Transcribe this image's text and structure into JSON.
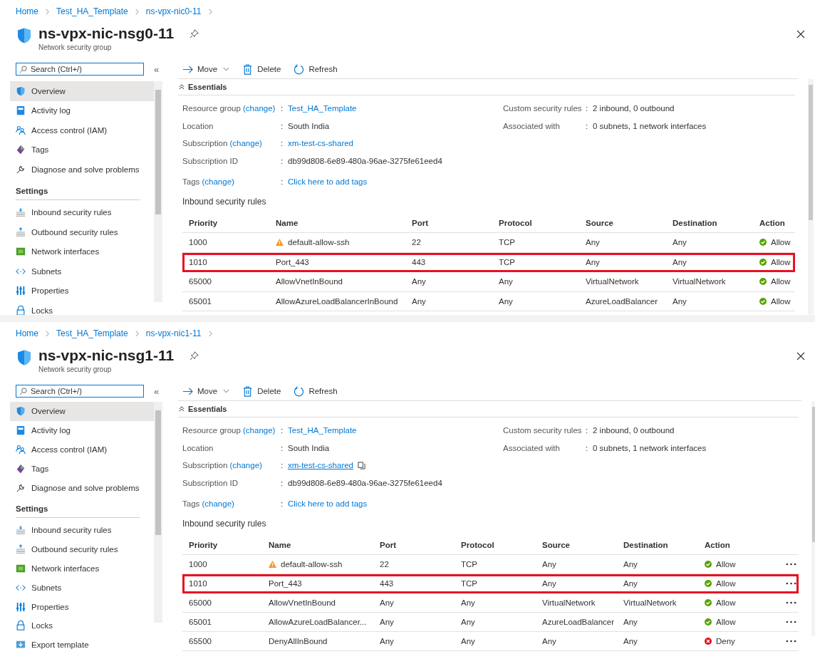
{
  "panels": [
    {
      "breadcrumb": [
        "Home",
        "Test_HA_Template",
        "ns-vpx-nic0-11"
      ],
      "title": "ns-vpx-nic-nsg0-11",
      "subtitle": "Network security group",
      "search": {
        "placeholder": "Search (Ctrl+/)"
      },
      "collapse": "«",
      "sidebar": {
        "items": [
          {
            "label": "Overview",
            "kind": "shield",
            "selected": true
          },
          {
            "label": "Activity log",
            "kind": "log",
            "selected": false
          },
          {
            "label": "Access control (IAM)",
            "kind": "people",
            "selected": false
          },
          {
            "label": "Tags",
            "kind": "tag",
            "selected": false
          },
          {
            "label": "Diagnose and solve problems",
            "kind": "wrench",
            "selected": false
          }
        ],
        "section": {
          "title": "Settings",
          "items": [
            {
              "label": "Inbound security rules",
              "kind": "inbound",
              "selected": false
            },
            {
              "label": "Outbound security rules",
              "kind": "outbound",
              "selected": false
            },
            {
              "label": "Network interfaces",
              "kind": "nic",
              "selected": false
            },
            {
              "label": "Subnets",
              "kind": "subnet",
              "selected": false
            },
            {
              "label": "Properties",
              "kind": "props",
              "selected": false
            },
            {
              "label": "Locks",
              "kind": "lock",
              "selected": false
            }
          ]
        }
      },
      "toolbar": [
        {
          "label": "Move",
          "kind": "move"
        },
        {
          "label": "Delete",
          "kind": "delete"
        },
        {
          "label": "Refresh",
          "kind": "refresh"
        }
      ],
      "essentials": {
        "title": "Essentials",
        "left": [
          {
            "label": "Resource group",
            "change": "(change)",
            "sep": ":",
            "value": "Test_HA_Template",
            "kind": "link",
            "copyable": false
          },
          {
            "label": "Location",
            "sep": ":",
            "value": "South India",
            "kind": "text",
            "copyable": false
          },
          {
            "label": "Subscription",
            "change": "(change)",
            "sep": ":",
            "value": "xm-test-cs-shared",
            "kind": "link",
            "copyable": false
          },
          {
            "label": "Subscription ID",
            "sep": ":",
            "value": "db99d808-6e89-480a-96ae-3275fe61eed4",
            "kind": "text",
            "copyable": false
          },
          {
            "label": "Tags",
            "change": "(change)",
            "sep": ":",
            "value": "Click here to add tags",
            "kind": "link",
            "copyable": false
          }
        ],
        "right": [
          {
            "label": "Custom security rules",
            "sep": ":",
            "value": "2 inbound, 0 outbound",
            "kind": "text",
            "copyable": false
          },
          {
            "label": "Associated with",
            "sep": ":",
            "value": "0 subnets, 1 network interfaces",
            "kind": "text",
            "copyable": false
          }
        ]
      },
      "rules": {
        "title": "Inbound security rules",
        "row_menu": false,
        "columns": [
          "Priority",
          "Name",
          "Port",
          "Protocol",
          "Source",
          "Destination",
          "Action"
        ],
        "rows": [
          {
            "priority": "1000",
            "name": "default-allow-ssh",
            "warning": true,
            "port": "22",
            "protocol": "TCP",
            "source": "Any",
            "destination": "Any",
            "action": "Allow",
            "kind": "allow",
            "highlighted": false
          },
          {
            "priority": "1010",
            "name": "Port_443",
            "warning": false,
            "port": "443",
            "protocol": "TCP",
            "source": "Any",
            "destination": "Any",
            "action": "Allow",
            "kind": "allow",
            "highlighted": true
          },
          {
            "priority": "65000",
            "name": "AllowVnetInBound",
            "warning": false,
            "port": "Any",
            "protocol": "Any",
            "source": "VirtualNetwork",
            "destination": "VirtualNetwork",
            "action": "Allow",
            "kind": "allow",
            "highlighted": false
          },
          {
            "priority": "65001",
            "name": "AllowAzureLoadBalancerInBound",
            "warning": false,
            "port": "Any",
            "protocol": "Any",
            "source": "AzureLoadBalancer",
            "destination": "Any",
            "action": "Allow",
            "kind": "allow",
            "highlighted": false
          }
        ]
      }
    },
    {
      "breadcrumb": [
        "Home",
        "Test_HA_Template",
        "ns-vpx-nic1-11"
      ],
      "title": "ns-vpx-nic-nsg1-11",
      "subtitle": "Network security group",
      "search": {
        "placeholder": "Search (Ctrl+/)"
      },
      "collapse": "«",
      "sidebar": {
        "items": [
          {
            "label": "Overview",
            "kind": "shield",
            "selected": true
          },
          {
            "label": "Activity log",
            "kind": "log",
            "selected": false
          },
          {
            "label": "Access control (IAM)",
            "kind": "people",
            "selected": false
          },
          {
            "label": "Tags",
            "kind": "tag",
            "selected": false
          },
          {
            "label": "Diagnose and solve problems",
            "kind": "wrench",
            "selected": false
          }
        ],
        "section": {
          "title": "Settings",
          "items": [
            {
              "label": "Inbound security rules",
              "kind": "inbound",
              "selected": false
            },
            {
              "label": "Outbound security rules",
              "kind": "outbound",
              "selected": false
            },
            {
              "label": "Network interfaces",
              "kind": "nic",
              "selected": false
            },
            {
              "label": "Subnets",
              "kind": "subnet",
              "selected": false
            },
            {
              "label": "Properties",
              "kind": "props",
              "selected": false
            },
            {
              "label": "Locks",
              "kind": "lock",
              "selected": false
            },
            {
              "label": "Export template",
              "kind": "export",
              "selected": false
            }
          ]
        }
      },
      "toolbar": [
        {
          "label": "Move",
          "kind": "move"
        },
        {
          "label": "Delete",
          "kind": "delete"
        },
        {
          "label": "Refresh",
          "kind": "refresh"
        }
      ],
      "essentials": {
        "title": "Essentials",
        "left": [
          {
            "label": "Resource group",
            "change": "(change)",
            "sep": ":",
            "value": "Test_HA_Template",
            "kind": "link",
            "copyable": false
          },
          {
            "label": "Location",
            "sep": ":",
            "value": "South India",
            "kind": "text",
            "copyable": false
          },
          {
            "label": "Subscription",
            "change": "(change)",
            "sep": ":",
            "value": "xm-test-cs-shared",
            "kind": "underlined",
            "copyable": true
          },
          {
            "label": "Subscription ID",
            "sep": ":",
            "value": "db99d808-6e89-480a-96ae-3275fe61eed4",
            "kind": "text",
            "copyable": false
          },
          {
            "label": "Tags",
            "change": "(change)",
            "sep": ":",
            "value": "Click here to add tags",
            "kind": "link",
            "copyable": false
          }
        ],
        "right": [
          {
            "label": "Custom security rules",
            "sep": ":",
            "value": "2 inbound, 0 outbound",
            "kind": "text",
            "copyable": false
          },
          {
            "label": "Associated with",
            "sep": ":",
            "value": "0 subnets, 1 network interfaces",
            "kind": "text",
            "copyable": false
          }
        ]
      },
      "rules": {
        "title": "Inbound security rules",
        "row_menu": true,
        "columns": [
          "Priority",
          "Name",
          "Port",
          "Protocol",
          "Source",
          "Destination",
          "Action"
        ],
        "rows": [
          {
            "priority": "1000",
            "name": "default-allow-ssh",
            "warning": true,
            "port": "22",
            "protocol": "TCP",
            "source": "Any",
            "destination": "Any",
            "action": "Allow",
            "kind": "allow",
            "highlighted": false
          },
          {
            "priority": "1010",
            "name": "Port_443",
            "warning": false,
            "port": "443",
            "protocol": "TCP",
            "source": "Any",
            "destination": "Any",
            "action": "Allow",
            "kind": "allow",
            "highlighted": true
          },
          {
            "priority": "65000",
            "name": "AllowVnetInBound",
            "warning": false,
            "port": "Any",
            "protocol": "Any",
            "source": "VirtualNetwork",
            "destination": "VirtualNetwork",
            "action": "Allow",
            "kind": "allow",
            "highlighted": false
          },
          {
            "priority": "65001",
            "name": "AllowAzureLoadBalancer...",
            "warning": false,
            "port": "Any",
            "protocol": "Any",
            "source": "AzureLoadBalancer",
            "destination": "Any",
            "action": "Allow",
            "kind": "allow",
            "highlighted": false
          },
          {
            "priority": "65500",
            "name": "DenyAllInBound",
            "warning": false,
            "port": "Any",
            "protocol": "Any",
            "source": "Any",
            "destination": "Any",
            "action": "Deny",
            "kind": "deny",
            "highlighted": false
          }
        ]
      }
    }
  ]
}
